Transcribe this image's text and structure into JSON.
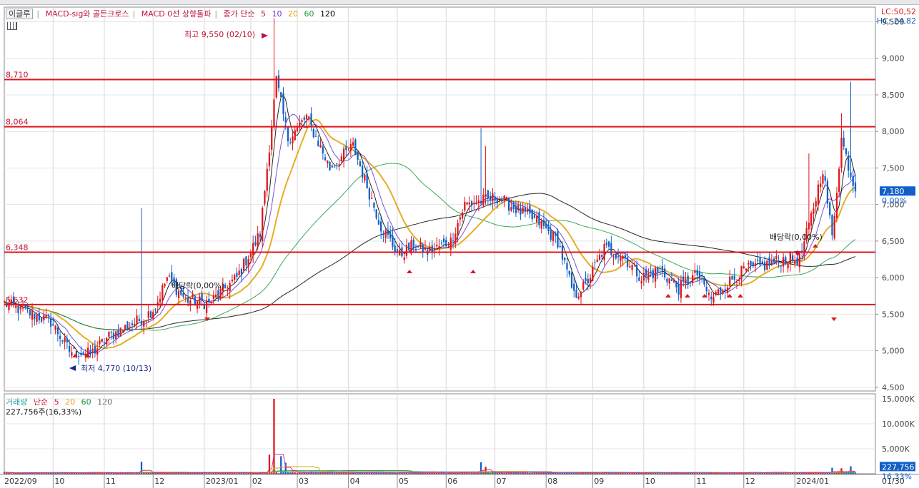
{
  "price_legend": {
    "tab": "이글루",
    "ind1": "MACD-sig와 골든크로스",
    "ind2": "MACD 0선 상향돌파",
    "ma_label": "종가 단순",
    "ma_periods": [
      "5",
      "10",
      "20",
      "60",
      "120"
    ]
  },
  "volume_legend": {
    "title": "거래량",
    "ma_label": "단순",
    "ma_periods": [
      "5",
      "20",
      "60",
      "120"
    ],
    "current": "227,756주(16,33%)"
  },
  "lc_hc": {
    "lc": "LC:50,52",
    "hc": "HC:-24,82"
  },
  "colors": {
    "up": "#e0151b",
    "down": "#1060c8",
    "ma5": "#000000",
    "ma10": "#6633cc",
    "ma20": "#e0a000",
    "ma60": "#1a9a3a",
    "ma120": "#000000",
    "hline": "#e0151b"
  },
  "chart_data": {
    "type": "candlestick",
    "price_axis": {
      "ylim": [
        4450,
        9700
      ],
      "ticks": [
        "9,500",
        "9,000",
        "8,500",
        "8,000",
        "7,500",
        "7,000",
        "6,500",
        "6,000",
        "5,500",
        "5,000",
        "4,500"
      ],
      "tick_values": [
        9500,
        9000,
        8500,
        8000,
        7500,
        7000,
        6500,
        6000,
        5500,
        5000,
        4500
      ]
    },
    "volume_axis": {
      "ylim": [
        0,
        16000
      ],
      "ticks": [
        "15,000K",
        "10,000K",
        "5,000K"
      ],
      "tick_values": [
        15000,
        10000,
        5000
      ]
    },
    "x_labels": [
      "2022/09",
      "10",
      "11",
      "12",
      "2023/01",
      "02",
      "03",
      "04",
      "05",
      "06",
      "07",
      "08",
      "09",
      "10",
      "11",
      "12",
      "2024/01",
      "01/30"
    ],
    "horizontal_lines": [
      {
        "label": "8,710",
        "value": 8710
      },
      {
        "label": "8,064",
        "value": 8064
      },
      {
        "label": "6,348",
        "value": 6348
      },
      {
        "label": "5,632",
        "value": 5632
      }
    ],
    "annotations": {
      "high": "최고 9,550 (02/10)",
      "low": "최저 4,770 (10/13)",
      "dividend1": "배당락(0,00%)",
      "dividend2": "배당락(0,00%)"
    },
    "current_price": {
      "label": "7,180",
      "value": 7180,
      "change": "0,00%"
    },
    "current_volume": {
      "label": "227,756",
      "change": "16,33%"
    },
    "anchors": [
      [
        0,
        5650
      ],
      [
        20,
        5400
      ],
      [
        28,
        5000
      ],
      [
        37,
        4950
      ],
      [
        45,
        5200
      ],
      [
        60,
        5450
      ],
      [
        65,
        5600
      ],
      [
        70,
        6000
      ],
      [
        78,
        5700
      ],
      [
        88,
        5650
      ],
      [
        100,
        6000
      ],
      [
        110,
        6600
      ],
      [
        117,
        8700
      ],
      [
        122,
        7900
      ],
      [
        130,
        8200
      ],
      [
        140,
        7500
      ],
      [
        150,
        7800
      ],
      [
        162,
        6700
      ],
      [
        170,
        6300
      ],
      [
        176,
        6450
      ],
      [
        182,
        6350
      ],
      [
        192,
        6500
      ],
      [
        198,
        7000
      ],
      [
        212,
        7100
      ],
      [
        222,
        6900
      ],
      [
        230,
        6750
      ],
      [
        238,
        6500
      ],
      [
        245,
        5750
      ],
      [
        250,
        5900
      ],
      [
        258,
        6400
      ],
      [
        266,
        6300
      ],
      [
        274,
        6000
      ],
      [
        282,
        6100
      ],
      [
        290,
        5850
      ],
      [
        298,
        6050
      ],
      [
        304,
        5700
      ],
      [
        310,
        5900
      ],
      [
        318,
        6100
      ],
      [
        325,
        6150
      ],
      [
        335,
        6250
      ],
      [
        342,
        6250
      ],
      [
        346,
        6700
      ],
      [
        352,
        7500
      ],
      [
        356,
        6550
      ],
      [
        360,
        7900
      ],
      [
        366,
        7180
      ]
    ],
    "spikes": [
      {
        "i": 59,
        "high": 6950
      },
      {
        "i": 116,
        "high": 9550
      },
      {
        "i": 117,
        "high": 8700
      },
      {
        "i": 119,
        "high": 8500
      },
      {
        "i": 205,
        "high": 8050
      },
      {
        "i": 207,
        "high": 7800
      },
      {
        "i": 346,
        "high": 7700
      },
      {
        "i": 364,
        "high": 8680
      },
      {
        "i": 360,
        "high": 8250
      }
    ],
    "volume_spikes": [
      {
        "i": 116,
        "v": 15000
      },
      {
        "i": 114,
        "v": 3800
      },
      {
        "i": 119,
        "v": 3500
      },
      {
        "i": 121,
        "v": 2200
      },
      {
        "i": 59,
        "v": 2400
      },
      {
        "i": 205,
        "v": 2300
      },
      {
        "i": 207,
        "v": 1400
      },
      {
        "i": 356,
        "v": 1200
      },
      {
        "i": 360,
        "v": 1100
      },
      {
        "i": 364,
        "v": 1500
      },
      {
        "i": 366,
        "v": 227.756
      }
    ],
    "n_bars": 367
  }
}
